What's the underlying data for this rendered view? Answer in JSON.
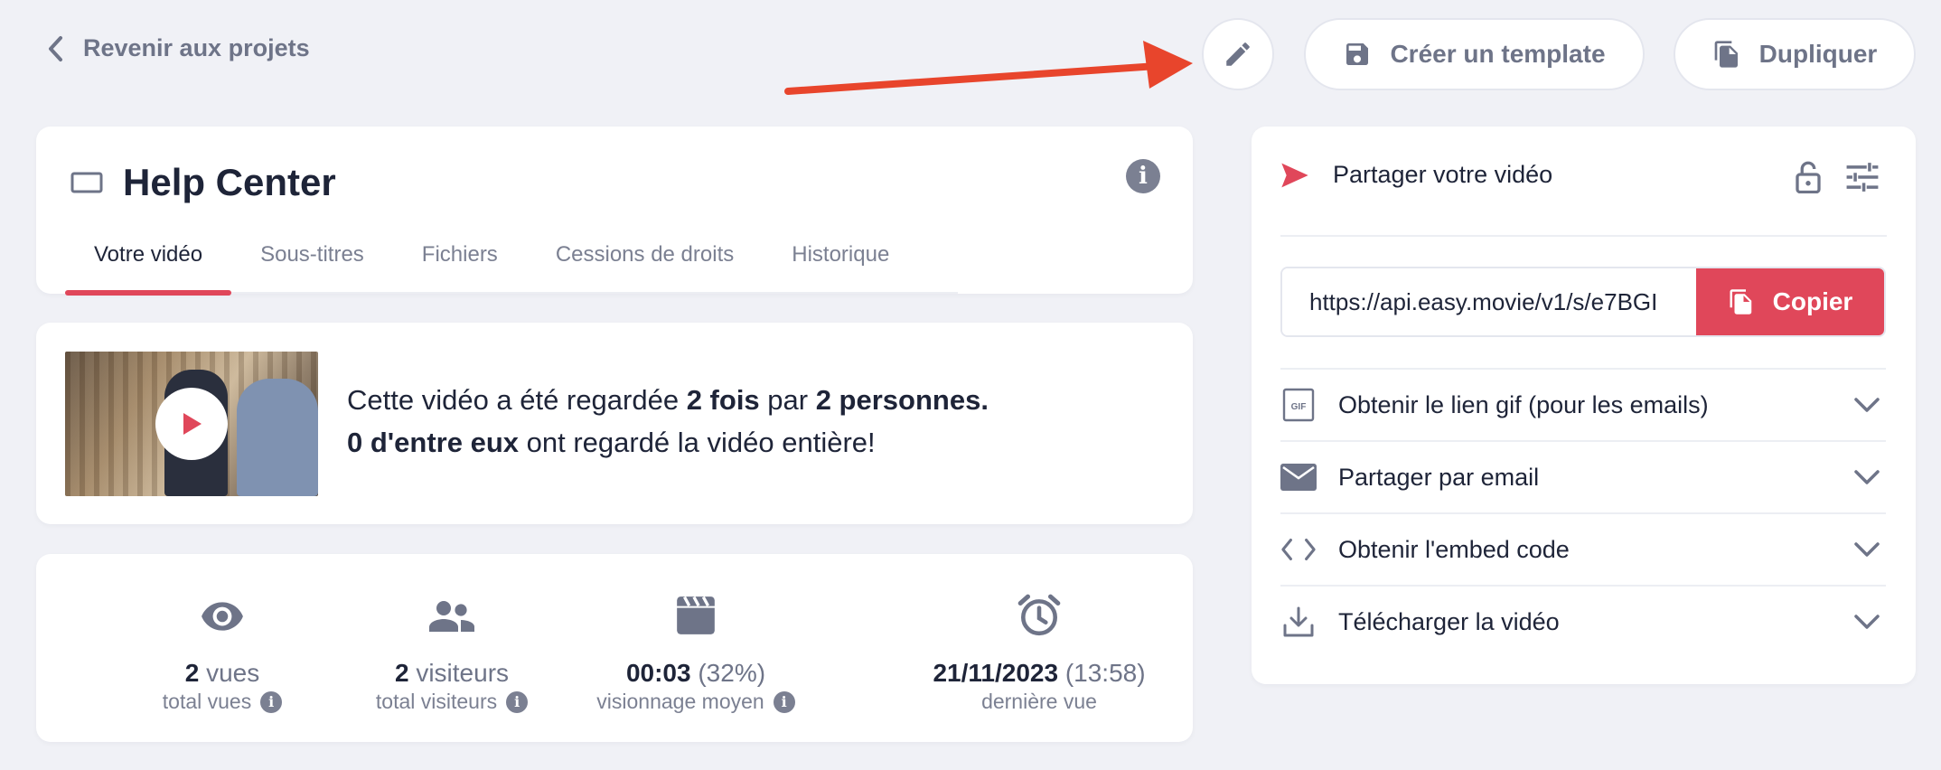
{
  "header": {
    "back_label": "Revenir aux projets",
    "create_template_label": "Créer un template",
    "duplicate_label": "Dupliquer"
  },
  "project": {
    "title": "Help Center",
    "tabs": [
      {
        "label": "Votre vidéo",
        "active": true
      },
      {
        "label": "Sous-titres",
        "active": false
      },
      {
        "label": "Fichiers",
        "active": false
      },
      {
        "label": "Cessions de droits",
        "active": false
      },
      {
        "label": "Historique",
        "active": false
      }
    ]
  },
  "views_summary": {
    "line1_prefix": "Cette vidéo a été regardée ",
    "line1_count": "2 fois",
    "line1_mid": " par ",
    "line1_people": "2 personnes.",
    "line2_count": "0 d'entre eux",
    "line2_suffix": " ont regardé la vidéo entière!"
  },
  "stats": [
    {
      "icon": "eye-icon",
      "value": "2",
      "unit": " vues",
      "label": "total vues",
      "info": true
    },
    {
      "icon": "people-icon",
      "value": "2",
      "unit": " visiteurs",
      "label": "total visiteurs",
      "info": true
    },
    {
      "icon": "clapperboard-icon",
      "value": "00:03",
      "unit": " (32%)",
      "label": "visionnage moyen",
      "info": true
    },
    {
      "icon": "alarm-clock-icon",
      "value": "21/11/2023",
      "unit": " (13:58)",
      "label": "dernière vue",
      "info": false
    }
  ],
  "share": {
    "title": "Partager votre vidéo",
    "url": "https://api.easy.movie/v1/s/e7BGI",
    "copy_label": "Copier",
    "accordion": [
      {
        "icon": "gif-icon",
        "label": "Obtenir le lien gif (pour les emails)"
      },
      {
        "icon": "envelope-icon",
        "label": "Partager par email"
      },
      {
        "icon": "code-icon",
        "label": "Obtenir l'embed code"
      },
      {
        "icon": "download-icon",
        "label": "Télécharger la vidéo"
      }
    ]
  },
  "colors": {
    "accent": "#e0475a",
    "arrow": "#e8452c",
    "text_dark": "#1e2438",
    "text_muted": "#7b8092",
    "background": "#f0f1f6"
  }
}
